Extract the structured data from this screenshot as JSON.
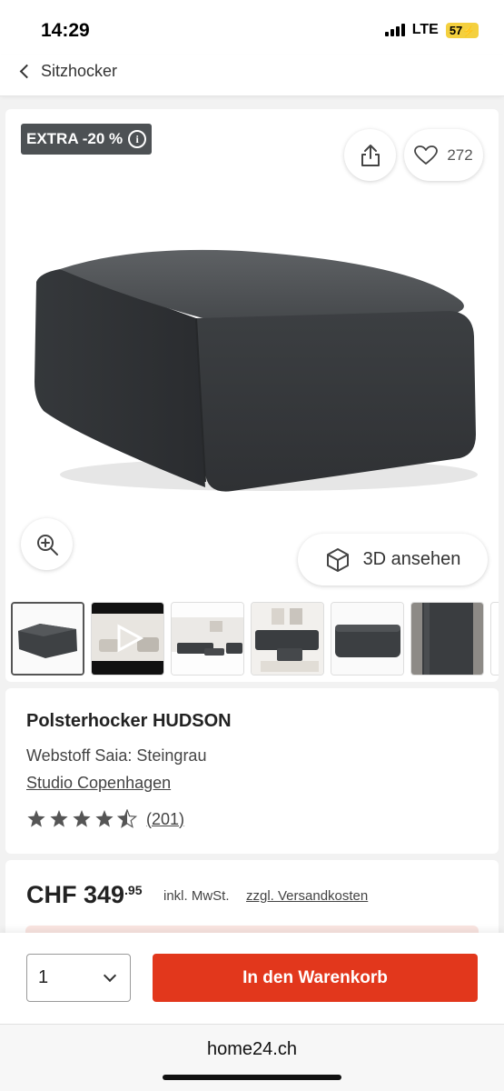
{
  "status_bar": {
    "time": "14:29",
    "network": "LTE",
    "battery": "57"
  },
  "nav": {
    "back_label": "Sitzhocker"
  },
  "image_card": {
    "badge_text": "EXTRA -20 %",
    "favorites_count": "272",
    "view_3d_label": "3D ansehen",
    "thumbnails": [
      {
        "name": "thumbnail-ottoman",
        "active": true
      },
      {
        "name": "thumbnail-video",
        "active": false
      },
      {
        "name": "thumbnail-living-room",
        "active": false
      },
      {
        "name": "thumbnail-sofa-set",
        "active": false
      },
      {
        "name": "thumbnail-ottoman-front",
        "active": false
      },
      {
        "name": "thumbnail-fabric-detail",
        "active": false
      }
    ]
  },
  "product": {
    "name": "Polsterhocker HUDSON",
    "variant": "Webstoff Saia: Steingrau",
    "brand": "Studio Copenhagen",
    "rating": 4.5,
    "rating_count": "(201)"
  },
  "price": {
    "currency_amount": "CHF 349",
    "cents": ".95",
    "tax_note": "inkl. MwSt.",
    "shipping_link": "zzgl. Versandkosten"
  },
  "cart": {
    "quantity": "1",
    "button_label": "In den Warenkorb"
  },
  "browser": {
    "domain": "home24.ch"
  },
  "colors": {
    "accent": "#e2371c",
    "badge": "#4d5154",
    "star": "#555555",
    "background": "#f2f2f2"
  }
}
